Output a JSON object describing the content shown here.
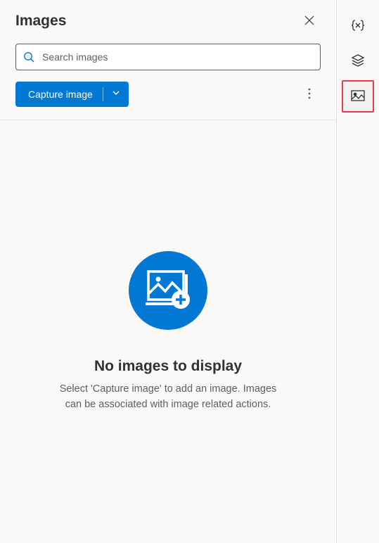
{
  "panel": {
    "title": "Images"
  },
  "search": {
    "placeholder": "Search images"
  },
  "toolbar": {
    "capture_label": "Capture image"
  },
  "empty": {
    "title": "No images to display",
    "message": "Select 'Capture image' to add an image. Images can be associated with image related actions."
  }
}
